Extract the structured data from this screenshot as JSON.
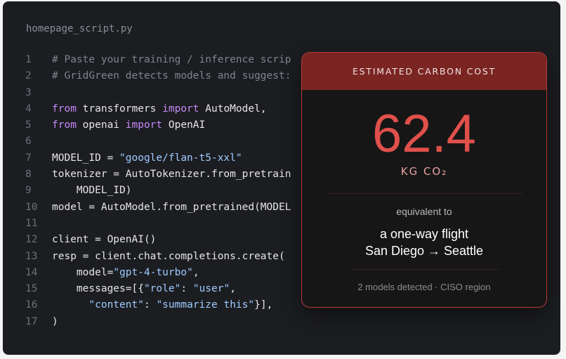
{
  "editor": {
    "filename": "homepage_script.py",
    "lines": [
      {
        "n": "1",
        "tokens": [
          {
            "t": "# Paste your training / inference scrip",
            "c": "c"
          }
        ]
      },
      {
        "n": "2",
        "tokens": [
          {
            "t": "# GridGreen detects models and suggest:",
            "c": "c"
          }
        ]
      },
      {
        "n": "3",
        "tokens": []
      },
      {
        "n": "4",
        "tokens": [
          {
            "t": "from",
            "c": "k"
          },
          {
            "t": " transformers ",
            "c": "p"
          },
          {
            "t": "import",
            "c": "k"
          },
          {
            "t": " AutoModel,",
            "c": "p"
          }
        ]
      },
      {
        "n": "5",
        "tokens": [
          {
            "t": "from",
            "c": "k"
          },
          {
            "t": " openai ",
            "c": "p"
          },
          {
            "t": "import",
            "c": "k"
          },
          {
            "t": " OpenAI",
            "c": "p"
          }
        ]
      },
      {
        "n": "6",
        "tokens": []
      },
      {
        "n": "7",
        "tokens": [
          {
            "t": "MODEL_ID = ",
            "c": "p"
          },
          {
            "t": "\"google/flan-t5-xxl\"",
            "c": "s"
          }
        ]
      },
      {
        "n": "8",
        "tokens": [
          {
            "t": "tokenizer = AutoTokenizer.from_pretrain",
            "c": "p"
          }
        ]
      },
      {
        "n": "9",
        "tokens": [
          {
            "t": "    MODEL_ID)",
            "c": "p"
          }
        ]
      },
      {
        "n": "10",
        "tokens": [
          {
            "t": "model = AutoModel.from_pretrained(MODEL",
            "c": "p"
          }
        ]
      },
      {
        "n": "11",
        "tokens": []
      },
      {
        "n": "12",
        "tokens": [
          {
            "t": "client = OpenAI()",
            "c": "p"
          }
        ]
      },
      {
        "n": "13",
        "tokens": [
          {
            "t": "resp = client.chat.completions.create(",
            "c": "p"
          }
        ]
      },
      {
        "n": "14",
        "tokens": [
          {
            "t": "    model=",
            "c": "p"
          },
          {
            "t": "\"gpt-4-turbo\"",
            "c": "s"
          },
          {
            "t": ",",
            "c": "p"
          }
        ]
      },
      {
        "n": "15",
        "tokens": [
          {
            "t": "    messages=[{",
            "c": "p"
          },
          {
            "t": "\"role\"",
            "c": "s"
          },
          {
            "t": ": ",
            "c": "p"
          },
          {
            "t": "\"user\"",
            "c": "s"
          },
          {
            "t": ",",
            "c": "p"
          }
        ]
      },
      {
        "n": "16",
        "tokens": [
          {
            "t": "      ",
            "c": "p"
          },
          {
            "t": "\"content\"",
            "c": "s"
          },
          {
            "t": ": ",
            "c": "p"
          },
          {
            "t": "\"summarize this\"",
            "c": "s"
          },
          {
            "t": "}],",
            "c": "p"
          }
        ]
      },
      {
        "n": "17",
        "tokens": [
          {
            "t": ")",
            "c": "p"
          }
        ]
      }
    ]
  },
  "carbon_card": {
    "header": "ESTIMATED CARBON COST",
    "value": "62.4",
    "unit": "KG CO₂",
    "equivalent_label": "equivalent to",
    "flight_line1": "a one-way flight",
    "flight_line2": "San Diego → Seattle",
    "footer": "2 models detected · CISO region"
  },
  "colors": {
    "background": "#1c1d21",
    "card_header": "#7a2522",
    "card_border": "#b63a36",
    "value": "#e0504b",
    "keyword": "#c58af9",
    "string": "#9ecbff",
    "comment": "#7e838d"
  }
}
